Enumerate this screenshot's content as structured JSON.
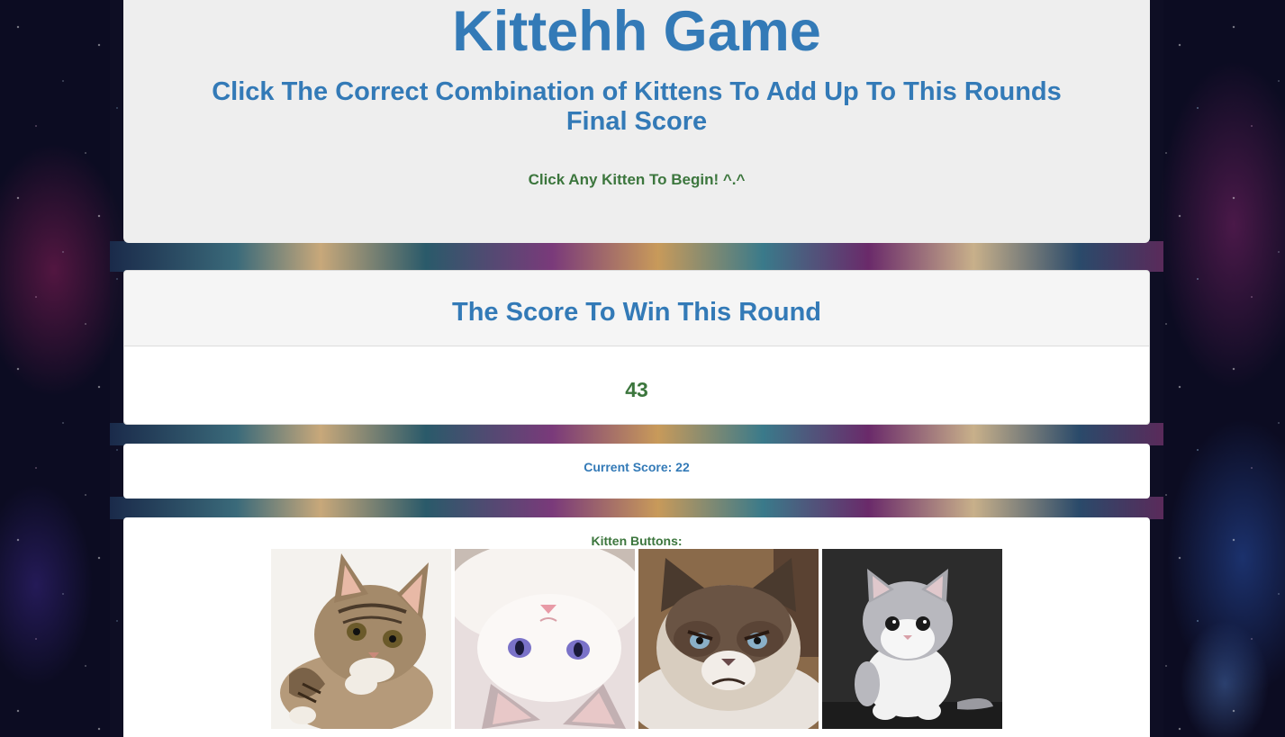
{
  "header": {
    "title": "Kittehh Game",
    "instructions": "Click The Correct Combination of Kittens To Add Up To This Rounds Final Score",
    "start_prompt": "Click Any Kitten To Begin! ^.^"
  },
  "target": {
    "heading": "The Score To Win This Round",
    "value": "43"
  },
  "current": {
    "text": "Current Score: 22"
  },
  "kittens": {
    "label": "Kitten Buttons:",
    "items": [
      {
        "icon": "tabby-kitten-icon"
      },
      {
        "icon": "white-kitten-upside-down-icon"
      },
      {
        "icon": "grumpy-cat-icon"
      },
      {
        "icon": "grey-white-kitten-icon"
      }
    ]
  }
}
